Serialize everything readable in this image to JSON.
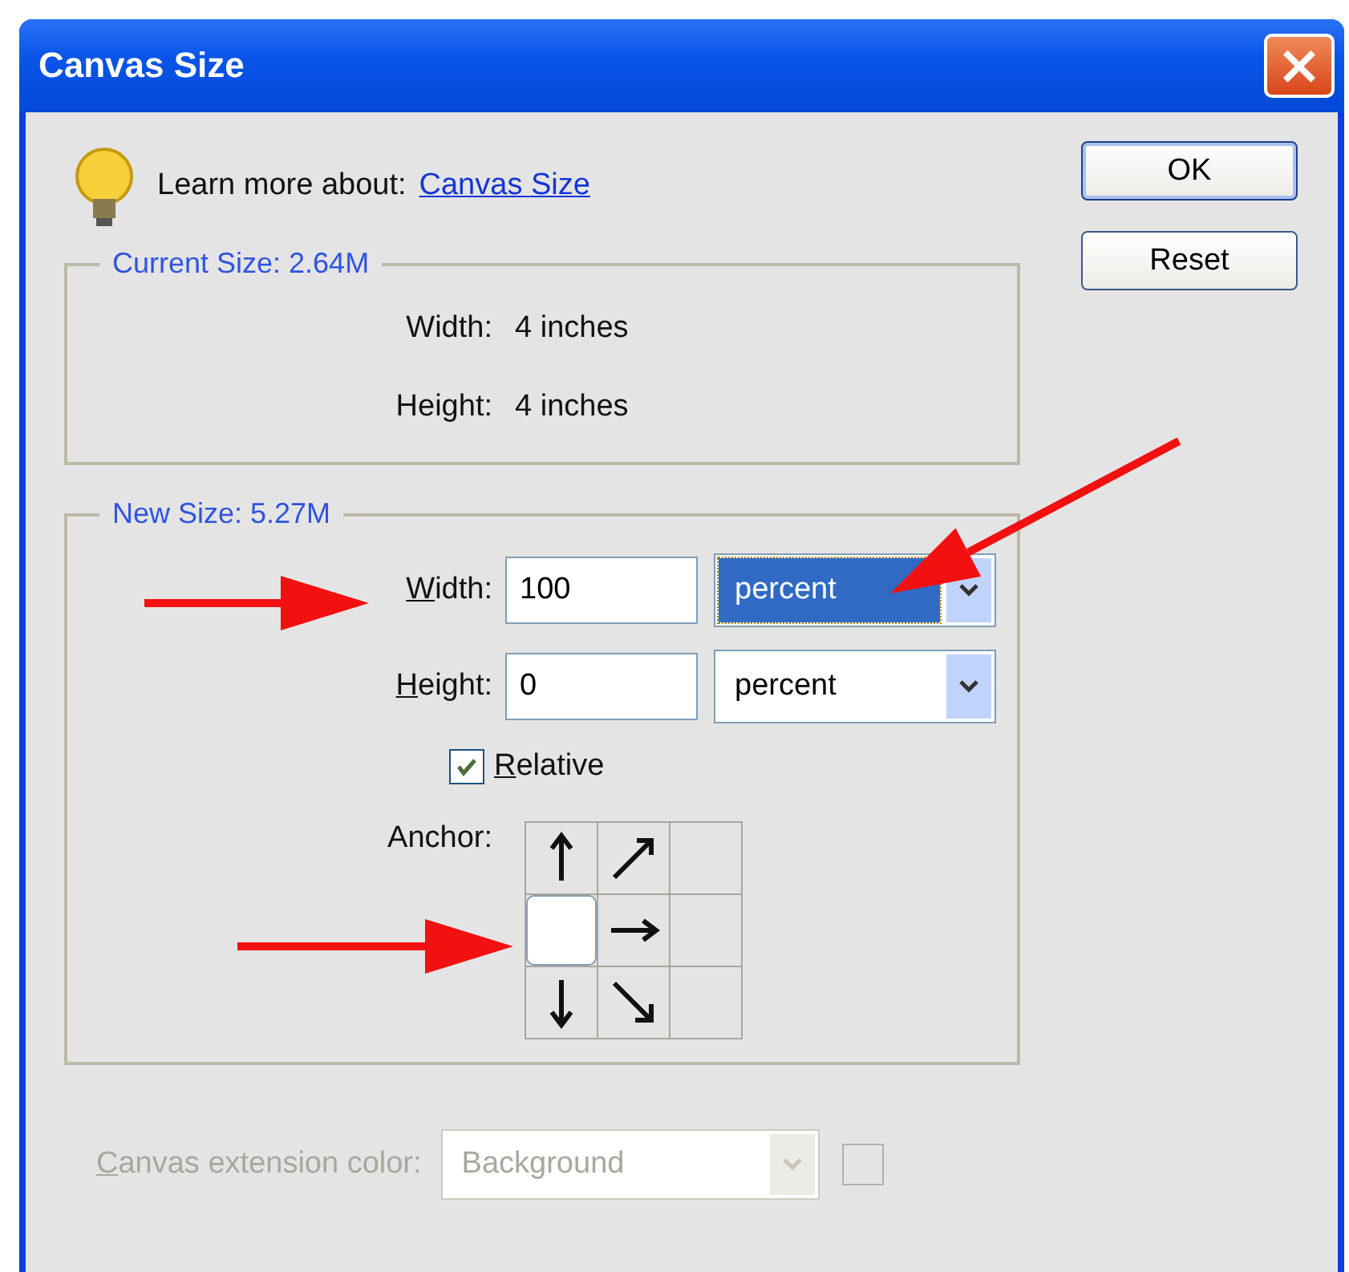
{
  "window": {
    "title": "Canvas Size",
    "close": "×"
  },
  "learn_more": {
    "text": "Learn more about:",
    "link": "Canvas Size"
  },
  "buttons": [
    {
      "label": "OK",
      "default": true
    },
    {
      "label": "Reset",
      "default": false
    }
  ],
  "current_size": {
    "legend": "Current Size: 2.64M",
    "rows": [
      {
        "label": "Width:",
        "value": "4 inches"
      },
      {
        "label": "Height:",
        "value": "4 inches"
      }
    ]
  },
  "new_size": {
    "legend": "New Size: 5.27M",
    "fields": [
      {
        "label": "Width:",
        "mnemonic": true,
        "value": "100",
        "unit": "percent",
        "focused": true
      },
      {
        "label": "Height:",
        "mnemonic": true,
        "value": "0",
        "unit": "percent",
        "focused": false
      }
    ],
    "relative": {
      "label": "Relative",
      "checked": true
    },
    "anchor": {
      "label": "Anchor:",
      "cells": [
        {
          "kind": "up",
          "selected": false
        },
        {
          "kind": "upright",
          "selected": false
        },
        {
          "kind": "blank",
          "selected": false
        },
        {
          "selected": true
        },
        {
          "kind": "right",
          "selected": false
        },
        {
          "kind": "blank",
          "selected": false
        },
        {
          "kind": "down",
          "selected": false
        },
        {
          "kind": "downright",
          "selected": false
        },
        {
          "kind": "blank",
          "selected": false
        }
      ]
    }
  },
  "extension_color": {
    "label": "Canvas extension color:",
    "value": "Background",
    "disabled": true
  },
  "annotations": [
    {
      "kind": "arrow"
    },
    {
      "kind": "arrow"
    },
    {
      "kind": "arrow"
    }
  ]
}
